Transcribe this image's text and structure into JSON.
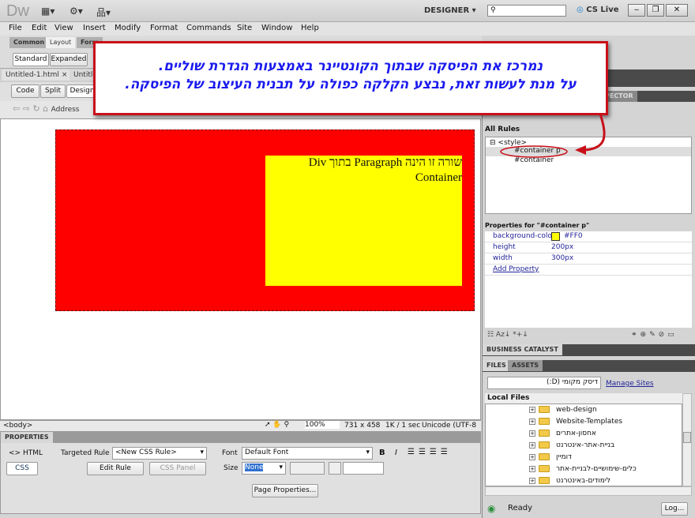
{
  "app": {
    "logo": "Dw",
    "workspace": "DESIGNER",
    "cs_live": "CS Live",
    "window_buttons": [
      "minimize",
      "restore",
      "close"
    ]
  },
  "menu": [
    "File",
    "Edit",
    "View",
    "Insert",
    "Modify",
    "Format",
    "Commands",
    "Site",
    "Window",
    "Help"
  ],
  "insert_bar": {
    "tabs": [
      "Common",
      "Layout",
      "Form"
    ],
    "active": "Layout",
    "modes": [
      "Standard",
      "Expanded"
    ]
  },
  "doc_tabs": [
    "Untitled-1.html",
    "Untitle"
  ],
  "view_buttons": [
    "Code",
    "Split",
    "Design"
  ],
  "address_label": "Address",
  "callout": {
    "line1": "נמרכז את הפיסקה שבתוך הקונטיינר באמצעות הגדרת שוליים.",
    "line2": "על מנת לעשות זאת, נבצע הקלקה כפולה על תבנית העיצוב של הפיסקה.",
    "border_color": "#c8101a",
    "text_color": "#1a1aee"
  },
  "canvas": {
    "container_color": "#FF0000",
    "paragraph_color": "#FFFF00",
    "paragraph_text": "שורה זו הינה Paragraph בתוך Div Container"
  },
  "statusbar": {
    "tag": "<body>",
    "zoom": "100%",
    "size": "731 x 458",
    "download": "1K / 1 sec",
    "encoding": "Unicode (UTF-8"
  },
  "properties": {
    "title": "PROPERTIES",
    "html": "HTML",
    "css": "CSS",
    "targeted_rule_label": "Targeted Rule",
    "targeted_rule": "<New CSS Rule>",
    "edit_rule": "Edit Rule",
    "css_panel": "CSS Panel",
    "font_label": "Font",
    "font": "Default Font",
    "size_label": "Size",
    "size": "None",
    "page_properties": "Page Properties..."
  },
  "css_panel": {
    "tab_partial": "PECTOR",
    "all_rules": "All Rules",
    "style": "<style>",
    "rules": [
      "#container p",
      "#container"
    ],
    "properties_title": "Properties for \"#container p\"",
    "props": [
      {
        "name": "background-color",
        "value": "#FF0"
      },
      {
        "name": "height",
        "value": "200px"
      },
      {
        "name": "width",
        "value": "300px"
      }
    ],
    "add_property": "Add Property"
  },
  "business_catalyst": "BUSINESS CATALYST",
  "files_panel": {
    "tabs": [
      "FILES",
      "ASSETS"
    ],
    "site": "דיסק מקומי (D:)",
    "manage_sites": "Manage Sites",
    "local_files": "Local Files",
    "items": [
      "web-design",
      "Website-Templates",
      "אחסון-אתרים",
      "בניית-אתר-אינטרנט",
      "דומיין",
      "כלים-שימושיים-לבניית-אתר",
      "לימודים-באינטרנט"
    ],
    "status": "Ready",
    "log": "Log..."
  }
}
